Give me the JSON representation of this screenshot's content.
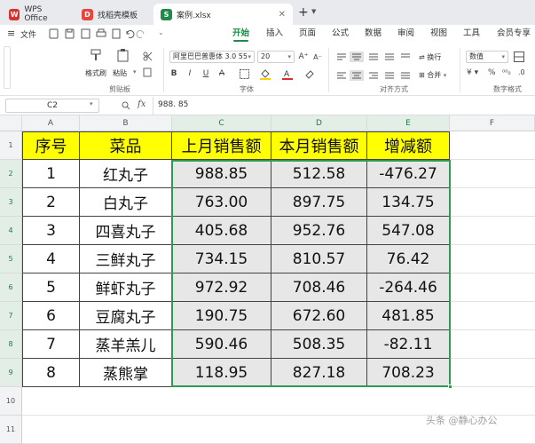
{
  "tabs": [
    {
      "label": "WPS Office",
      "icon": "wps-logo-icon",
      "color": "#d9312b"
    },
    {
      "label": "找稻壳模板",
      "icon": "docer-icon",
      "color": "#e8453c"
    },
    {
      "label": "案例.xlsx",
      "icon": "spreadsheet-icon",
      "color": "#1f8a49"
    }
  ],
  "new_tab": "+",
  "menu": {
    "file": "文件",
    "tabs": [
      "开始",
      "插入",
      "页面",
      "公式",
      "数据",
      "审阅",
      "视图",
      "工具",
      "会员专享"
    ],
    "active": "开始"
  },
  "ribbon": {
    "format_painter": "格式刷",
    "paste": "粘贴",
    "clipboard_group": "剪贴板",
    "font_name": "阿里巴巴普惠体 3.0 55",
    "font_size": "20",
    "font_group": "字体",
    "wrap": "换行",
    "merge": "合并",
    "align_group": "对齐方式",
    "number_format": "数值",
    "number_group": "数字格式"
  },
  "formula_bar": {
    "name_box": "C2",
    "fx": "fx",
    "content": "988. 85"
  },
  "columns": [
    "A",
    "B",
    "C",
    "D",
    "E",
    "F"
  ],
  "rows": [
    "1",
    "2",
    "3",
    "4",
    "5",
    "6",
    "7",
    "8",
    "9",
    "10",
    "11"
  ],
  "table": {
    "headers": [
      "序号",
      "菜品",
      "上月销售额",
      "本月销售额",
      "增减额"
    ],
    "rows": [
      [
        "1",
        "红丸子",
        "988.85",
        "512.58",
        "-476.27"
      ],
      [
        "2",
        "白丸子",
        "763.00",
        "897.75",
        "134.75"
      ],
      [
        "3",
        "四喜丸子",
        "405.68",
        "952.76",
        "547.08"
      ],
      [
        "4",
        "三鲜丸子",
        "734.15",
        "810.57",
        "76.42"
      ],
      [
        "5",
        "鲜虾丸子",
        "972.92",
        "708.46",
        "-264.46"
      ],
      [
        "6",
        "豆腐丸子",
        "190.75",
        "672.60",
        "481.85"
      ],
      [
        "7",
        "蒸羊羔儿",
        "590.46",
        "508.35",
        "-82.11"
      ],
      [
        "8",
        "蒸熊掌",
        "118.95",
        "827.18",
        "708.23"
      ]
    ]
  },
  "watermark": "头条 @静心办公",
  "colors": {
    "accent": "#1f8a49",
    "header_fill": "#ffff00",
    "number_fill": "#e7e7e7"
  }
}
